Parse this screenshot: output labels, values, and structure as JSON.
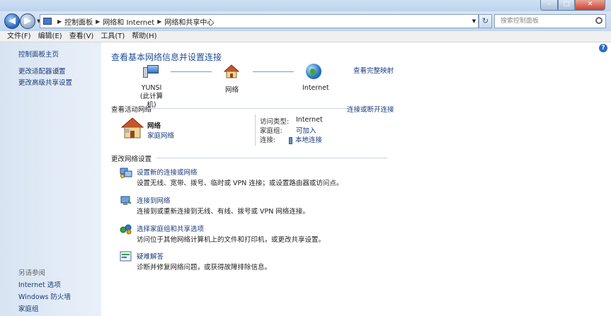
{
  "window": {
    "min_glyph": "–",
    "max_glyph": "□",
    "close_glyph": "✕"
  },
  "address": {
    "crumbs": [
      "控制面板",
      "网络和 Internet",
      "网络和共享中心"
    ],
    "search_placeholder": "搜索控制面板"
  },
  "menu": [
    "文件(F)",
    "编辑(E)",
    "查看(V)",
    "工具(T)",
    "帮助(H)"
  ],
  "sidebar": {
    "home": "控制面板主页",
    "adapter": "更改适配器设置",
    "sharing": "更改高级共享设置",
    "see_also": "另请参阅",
    "links": [
      "Internet 选项",
      "Windows 防火墙",
      "家庭组"
    ]
  },
  "main": {
    "title": "查看基本网络信息并设置连接",
    "full_map": "查看完整映射",
    "nodes": {
      "computer_name": "YUNSI",
      "computer_sub": "(此计算机)",
      "network": "网络",
      "internet": "Internet"
    },
    "active": {
      "header": "查看活动网络",
      "connect_link": "连接或断开连接",
      "name": "网络",
      "type": "家庭网络",
      "access_label": "访问类型:",
      "access_value": "Internet",
      "homegroup_label": "家庭组:",
      "homegroup_value": "可加入",
      "conn_label": "连接:",
      "conn_value": "本地连接"
    },
    "change_header": "更改网络设置",
    "tasks": [
      {
        "title": "设置新的连接或网络",
        "desc": "设置无线、宽带、拨号、临时或 VPN 连接；或设置路由器或访问点。"
      },
      {
        "title": "连接到网络",
        "desc": "连接到或重新连接到无线、有线、拨号或 VPN 网络连接。"
      },
      {
        "title": "选择家庭组和共享选项",
        "desc": "访问位于其他网络计算机上的文件和打印机，或更改共享设置。"
      },
      {
        "title": "疑难解答",
        "desc": "诊断并修复网络问题，或获得故障排除信息。"
      }
    ]
  },
  "colors": {
    "link": "#1a3b7a",
    "title": "#1f4f99",
    "sidebar": "#dde7f4"
  }
}
